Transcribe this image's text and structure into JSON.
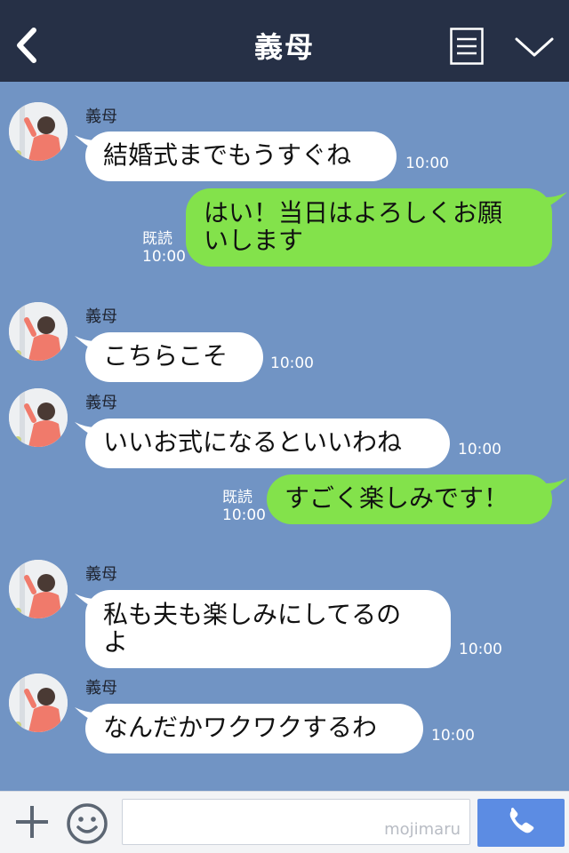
{
  "header": {
    "title": "義母"
  },
  "messages": [
    {
      "sender": "義母",
      "text": "結婚式までもうすぐね",
      "time": "10:00"
    },
    {
      "text_line1": "はい！当日はよろしくお願",
      "text_line2": "いします",
      "read": "既読",
      "time": "10:00"
    },
    {
      "sender": "義母",
      "text": "こちらこそ",
      "time": "10:00"
    },
    {
      "sender": "義母",
      "text": "いいお式になるといいわね",
      "time": "10:00"
    },
    {
      "text": "すごく楽しみです！",
      "read": "既読",
      "time": "10:00"
    },
    {
      "sender": "義母",
      "text_line1": "私も夫も楽しみにしてるの",
      "text_line2": "よ",
      "time": "10:00"
    },
    {
      "sender": "義母",
      "text": "なんだかワクワクするわ",
      "time": "10:00"
    }
  ],
  "footer": {
    "watermark": "mojimaru"
  },
  "colors": {
    "header_bg": "#263046",
    "chat_bg": "#7194c4",
    "incoming_bubble": "#ffffff",
    "outgoing_bubble": "#83e24b",
    "call_button": "#5c8ce3"
  },
  "icons": [
    "back-arrow-icon",
    "menu-icon",
    "chevron-down-icon",
    "plus-icon",
    "emoji-icon",
    "phone-icon"
  ]
}
